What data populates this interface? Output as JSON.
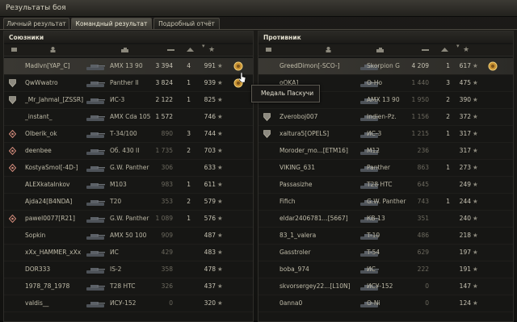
{
  "window": {
    "title": "Результаты боя"
  },
  "tabs": [
    {
      "label": "Личный результат",
      "active": false
    },
    {
      "label": "Командный результат",
      "active": true
    },
    {
      "label": "Подробный отчёт",
      "active": false
    }
  ],
  "allies": {
    "title": "Союзники",
    "rows": [
      {
        "name": "Madlvn[YAP_C]",
        "tank": "AMX 13 90",
        "damage": "3 394",
        "frags": "4",
        "xp": "991",
        "medal": true,
        "rank": "none",
        "dim": false
      },
      {
        "name": "QwWwatro",
        "tank": "Panther II",
        "damage": "3 824",
        "frags": "1",
        "xp": "939",
        "medal": true,
        "rank": "shield",
        "dim": false
      },
      {
        "name": "_Mr_Jahmal_[ZSSR]",
        "tank": "ИС-3",
        "damage": "2 122",
        "frags": "1",
        "xp": "825",
        "medal": false,
        "rank": "shield",
        "dim": false
      },
      {
        "name": "_instant_",
        "tank": "AMX Cda 105",
        "damage": "1 572",
        "frags": "",
        "xp": "746",
        "medal": false,
        "rank": "none",
        "dim": false
      },
      {
        "name": "Olberik_ok",
        "tank": "Т-34/100",
        "damage": "890",
        "frags": "3",
        "xp": "744",
        "medal": false,
        "rank": "diamond",
        "dim": true
      },
      {
        "name": "deenbee",
        "tank": "Об. 430 II",
        "damage": "1 735",
        "frags": "2",
        "xp": "703",
        "medal": false,
        "rank": "diamond",
        "dim": true
      },
      {
        "name": "KostyaSmol[-4D-]",
        "tank": "G.W. Panther",
        "damage": "306",
        "frags": "",
        "xp": "633",
        "medal": false,
        "rank": "diamond",
        "dim": true
      },
      {
        "name": "ALEXkatalnkov",
        "tank": "M103",
        "damage": "983",
        "frags": "1",
        "xp": "611",
        "medal": false,
        "rank": "none",
        "dim": true
      },
      {
        "name": "Ajda24[B4NDA]",
        "tank": "T20",
        "damage": "353",
        "frags": "2",
        "xp": "579",
        "medal": false,
        "rank": "none",
        "dim": true
      },
      {
        "name": "pawel0077[R21]",
        "tank": "G.W. Panther",
        "damage": "1 089",
        "frags": "1",
        "xp": "576",
        "medal": false,
        "rank": "diamond",
        "dim": true
      },
      {
        "name": "Sopkin",
        "tank": "AMX 50 100",
        "damage": "909",
        "frags": "",
        "xp": "487",
        "medal": false,
        "rank": "none",
        "dim": true
      },
      {
        "name": "xXx_HAMMER_xXx",
        "tank": "ИС",
        "damage": "429",
        "frags": "",
        "xp": "483",
        "medal": false,
        "rank": "none",
        "dim": true
      },
      {
        "name": "DOR333",
        "tank": "IS-2",
        "damage": "358",
        "frags": "",
        "xp": "478",
        "medal": false,
        "rank": "none",
        "dim": true
      },
      {
        "name": "1978_78_1978",
        "tank": "T28 HTC",
        "damage": "326",
        "frags": "",
        "xp": "437",
        "medal": false,
        "rank": "none",
        "dim": true
      },
      {
        "name": "valdis__",
        "tank": "ИСУ-152",
        "damage": "0",
        "frags": "",
        "xp": "320",
        "medal": false,
        "rank": "none",
        "dim": true
      }
    ]
  },
  "enemies": {
    "title": "Противник",
    "rows": [
      {
        "name": "GreedDimon[-SCO-]",
        "tank": "Skorpion G",
        "damage": "4 209",
        "frags": "1",
        "xp": "617",
        "medal": true,
        "rank": "none",
        "dim": false
      },
      {
        "name": "oOKA]",
        "tank": "O-Ho",
        "damage": "1 440",
        "frags": "3",
        "xp": "475",
        "medal": false,
        "rank": "none",
        "dim": true
      },
      {
        "name": "",
        "tank": "AMX 13 90",
        "damage": "1 950",
        "frags": "2",
        "xp": "390",
        "medal": false,
        "rank": "none",
        "dim": true
      },
      {
        "name": "Zveroboj007",
        "tank": "Indien-Pz.",
        "damage": "1 156",
        "frags": "2",
        "xp": "372",
        "medal": false,
        "rank": "shield",
        "dim": true
      },
      {
        "name": "xaltura5[OPELS]",
        "tank": "ИС-3",
        "damage": "1 215",
        "frags": "1",
        "xp": "317",
        "medal": false,
        "rank": "shield",
        "dim": true
      },
      {
        "name": "Moroder_mo...[ETM16]",
        "tank": "M12",
        "damage": "236",
        "frags": "",
        "xp": "317",
        "medal": false,
        "rank": "none",
        "dim": true
      },
      {
        "name": "VIKING_631",
        "tank": "Panther",
        "damage": "863",
        "frags": "1",
        "xp": "273",
        "medal": false,
        "rank": "none",
        "dim": true
      },
      {
        "name": "Passasizhe",
        "tank": "T28 HTC",
        "damage": "645",
        "frags": "",
        "xp": "249",
        "medal": false,
        "rank": "none",
        "dim": true
      },
      {
        "name": "Fifich",
        "tank": "G.W. Panther",
        "damage": "743",
        "frags": "1",
        "xp": "244",
        "medal": false,
        "rank": "none",
        "dim": true
      },
      {
        "name": "eldar2406781...[5667]",
        "tank": "КВ-13",
        "damage": "351",
        "frags": "",
        "xp": "240",
        "medal": false,
        "rank": "none",
        "dim": true
      },
      {
        "name": "83_1_valera",
        "tank": "T-10",
        "damage": "486",
        "frags": "",
        "xp": "218",
        "medal": false,
        "rank": "none",
        "dim": true
      },
      {
        "name": "Gasstroler",
        "tank": "T-54",
        "damage": "629",
        "frags": "",
        "xp": "197",
        "medal": false,
        "rank": "none",
        "dim": true
      },
      {
        "name": "boba_974",
        "tank": "ИС",
        "damage": "222",
        "frags": "",
        "xp": "191",
        "medal": false,
        "rank": "none",
        "dim": true
      },
      {
        "name": "skvorsergey22...[L10N]",
        "tank": "ИСУ-152",
        "damage": "0",
        "frags": "",
        "xp": "147",
        "medal": false,
        "rank": "none",
        "dim": true
      },
      {
        "name": "0anna0",
        "tank": "O-Ni",
        "damage": "0",
        "frags": "",
        "xp": "124",
        "medal": false,
        "rank": "none",
        "dim": true
      }
    ]
  },
  "tooltip": {
    "text": "Медаль Паскучи"
  },
  "colors": {
    "accent": "#d6a640",
    "medal": "#c89232"
  }
}
